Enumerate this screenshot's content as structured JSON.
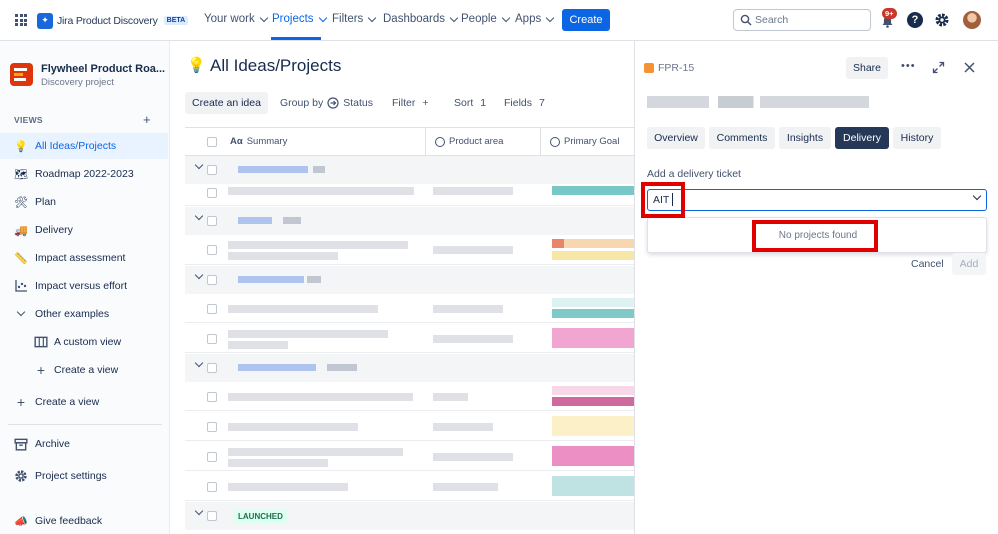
{
  "topnav": {
    "product_name": "Jira Product Discovery",
    "beta_badge": "BETA",
    "items": [
      {
        "label": "Your work"
      },
      {
        "label": "Projects"
      },
      {
        "label": "Filters"
      },
      {
        "label": "Dashboards"
      },
      {
        "label": "People"
      },
      {
        "label": "Apps"
      }
    ],
    "create_label": "Create",
    "search_placeholder": "Search",
    "notifications_badge": "9+",
    "icons": [
      "app-switcher-icon",
      "bell-icon",
      "help-icon",
      "gear-icon",
      "avatar"
    ]
  },
  "sidebar": {
    "project_name": "Flywheel Product Roa...",
    "project_type": "Discovery project",
    "views_heading": "VIEWS",
    "views_add": "+",
    "items": [
      {
        "label": "All Ideas/Projects",
        "icon": "💡"
      },
      {
        "label": "Roadmap 2022-2023",
        "icon": "🗺"
      },
      {
        "label": "Plan",
        "icon": "🛠"
      },
      {
        "label": "Delivery",
        "icon": "🚚"
      },
      {
        "label": "Impact assessment",
        "icon": "📏"
      },
      {
        "label": "Impact versus effort",
        "icon": "scatter-icon"
      },
      {
        "label": "Other examples",
        "icon": "chevron-down-icon"
      },
      {
        "label": "A custom view",
        "icon": "table-icon"
      },
      {
        "label": "Create a view",
        "icon": "plus-icon"
      },
      {
        "label": "Create a view",
        "icon": "plus-icon"
      },
      {
        "label": "Archive",
        "icon": "archive-icon"
      },
      {
        "label": "Project settings",
        "icon": "gear-icon"
      },
      {
        "label": "Give feedback",
        "icon": "megaphone-icon"
      }
    ]
  },
  "main": {
    "title": "All Ideas/Projects",
    "title_icon": "💡",
    "toolbar": {
      "create_label": "Create an idea",
      "group_by_label": "Group by",
      "group_by_value": "Status",
      "filter_label": "Filter",
      "filter_add": "+",
      "sort_label": "Sort",
      "sort_count": "1",
      "fields_label": "Fields",
      "fields_count": "7"
    },
    "columns": [
      {
        "label": "Summary",
        "icon": "Aα"
      },
      {
        "label": "Product area"
      },
      {
        "label": "Primary Goal"
      }
    ],
    "launched_label": "LAUNCHED"
  },
  "panel": {
    "issue_key": "FPR-15",
    "share_label": "Share",
    "more_label": "•••",
    "tabs": [
      "Overview",
      "Comments",
      "Insights",
      "Delivery",
      "History"
    ],
    "active_tab": "Delivery",
    "delivery_label": "Add a delivery ticket",
    "input_value": "AIT",
    "no_results": "No projects found",
    "cancel_label": "Cancel",
    "add_label": "Add"
  },
  "colors": {
    "accent": "#0c66e4",
    "annotation_red": "#e00000",
    "active_tab": "#253858"
  }
}
